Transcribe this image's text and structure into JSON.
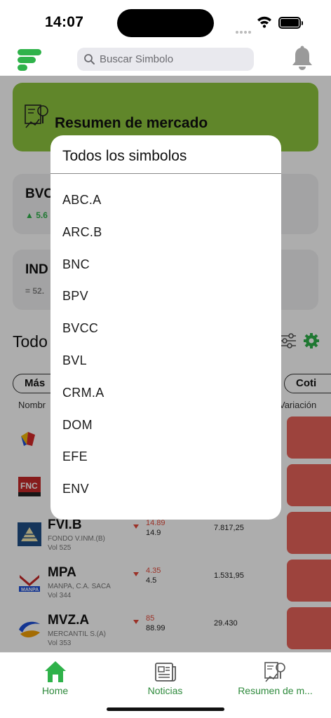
{
  "status_bar": {
    "time": "14:07"
  },
  "header": {
    "search_placeholder": "Buscar Simbolo"
  },
  "banner": {
    "title": "Resumen de mercado"
  },
  "indices": [
    {
      "name": "BVC",
      "change": "▲ 5.6"
    },
    {
      "name": "IND",
      "change": "= 52."
    }
  ],
  "section": {
    "title": "Todo"
  },
  "filters": {
    "left_pill": "Más",
    "right_pill": "Coti"
  },
  "columns": {
    "name": "Nombr",
    "variation": "Variación"
  },
  "stocks": [
    {
      "symbol": "FVI.B",
      "desc": "FONDO V.INM.(B)",
      "vol": "Vol 525",
      "price_prev": "14.89",
      "price": "14.9",
      "amount": "7.817,25"
    },
    {
      "symbol": "MPA",
      "desc": "MANPA, C.A. SACA",
      "vol": "Vol 344",
      "price_prev": "4.35",
      "price": "4.5",
      "amount": "1.531,95"
    },
    {
      "symbol": "MVZ.A",
      "desc": "MERCANTIL S.(A)",
      "vol": "Vol 353",
      "price_prev": "85",
      "price": "88.99",
      "amount": "29.430"
    }
  ],
  "modal": {
    "title": "Todos los simbolos",
    "items": [
      "ABC.A",
      "ARC.B",
      "BNC",
      "BPV",
      "BVCC",
      "BVL",
      "CRM.A",
      "DOM",
      "EFE",
      "ENV"
    ]
  },
  "tabs": [
    {
      "label": "Home",
      "icon": "home-icon"
    },
    {
      "label": "Noticias",
      "icon": "news-icon"
    },
    {
      "label": "Resumen de m...",
      "icon": "market-summary-icon"
    }
  ],
  "colors": {
    "accent_green": "#2fb24a",
    "banner_green": "#8ec63f",
    "negative_red": "#e8645a"
  }
}
